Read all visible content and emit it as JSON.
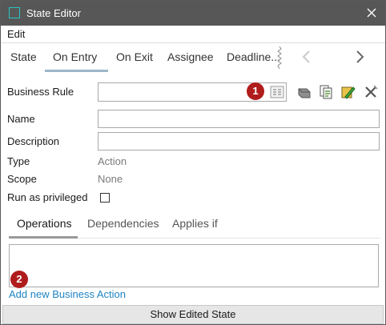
{
  "window": {
    "title": "State Editor"
  },
  "menu": {
    "edit": "Edit"
  },
  "tabs": [
    {
      "label": "State"
    },
    {
      "label": "On Entry",
      "active": true
    },
    {
      "label": "On Exit"
    },
    {
      "label": "Assignee"
    },
    {
      "label": "Deadline..."
    }
  ],
  "form": {
    "business_rule": {
      "label": "Business Rule",
      "value": ""
    },
    "name": {
      "label": "Name",
      "value": ""
    },
    "description": {
      "label": "Description",
      "value": ""
    },
    "type": {
      "label": "Type",
      "value": "Action"
    },
    "scope": {
      "label": "Scope",
      "value": "None"
    },
    "run_as_privileged": {
      "label": "Run as privileged",
      "checked": false
    }
  },
  "badges": {
    "first": "1",
    "second": "2"
  },
  "subtabs": [
    {
      "label": "Operations",
      "active": true
    },
    {
      "label": "Dependencies"
    },
    {
      "label": "Applies if"
    }
  ],
  "operations": {
    "add_link": "Add new Business Action"
  },
  "footer": {
    "button": "Show Edited State"
  },
  "colors": {
    "titlebar": "#575757",
    "accent": "#27c5c5",
    "badge": "#b01c1c",
    "link": "#1f84c4"
  }
}
